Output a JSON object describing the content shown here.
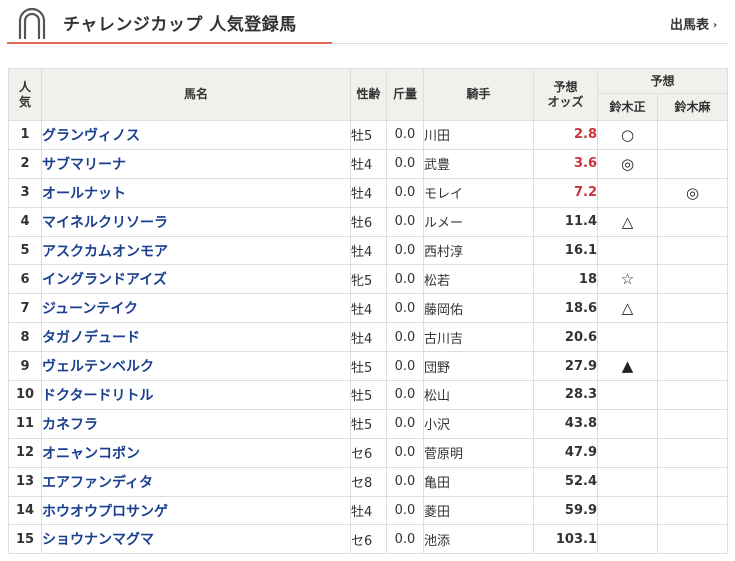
{
  "header": {
    "title": "チャレンジカップ 人気登録馬",
    "link_label": "出馬表",
    "chevron": "›"
  },
  "table": {
    "columns": {
      "rank": "人\n気",
      "horse": "馬名",
      "sex_age": "性齢",
      "weight": "斤量",
      "jockey": "騎手",
      "odds": "予想\nオッズ",
      "prediction_group": "予想",
      "pred1": "鈴木正",
      "pred2": "鈴木麻"
    },
    "rows": [
      {
        "rank": "1",
        "horse": "グランヴィノス",
        "sex_age": "牡5",
        "weight": "0.0",
        "jockey": "川田",
        "odds": "2.8",
        "hot": true,
        "pred1": "○",
        "pred2": ""
      },
      {
        "rank": "2",
        "horse": "サブマリーナ",
        "sex_age": "牡4",
        "weight": "0.0",
        "jockey": "武豊",
        "odds": "3.6",
        "hot": true,
        "pred1": "◎",
        "pred2": ""
      },
      {
        "rank": "3",
        "horse": "オールナット",
        "sex_age": "牡4",
        "weight": "0.0",
        "jockey": "モレイ",
        "odds": "7.2",
        "hot": true,
        "pred1": "",
        "pred2": "◎"
      },
      {
        "rank": "4",
        "horse": "マイネルクリソーラ",
        "sex_age": "牡6",
        "weight": "0.0",
        "jockey": "ルメー",
        "odds": "11.4",
        "hot": false,
        "pred1": "△",
        "pred2": ""
      },
      {
        "rank": "5",
        "horse": "アスクカムオンモア",
        "sex_age": "牡4",
        "weight": "0.0",
        "jockey": "西村淳",
        "odds": "16.1",
        "hot": false,
        "pred1": "",
        "pred2": ""
      },
      {
        "rank": "6",
        "horse": "イングランドアイズ",
        "sex_age": "牝5",
        "weight": "0.0",
        "jockey": "松若",
        "odds": "18",
        "hot": false,
        "pred1": "☆",
        "pred2": ""
      },
      {
        "rank": "7",
        "horse": "ジューンテイク",
        "sex_age": "牡4",
        "weight": "0.0",
        "jockey": "藤岡佑",
        "odds": "18.6",
        "hot": false,
        "pred1": "△",
        "pred2": ""
      },
      {
        "rank": "8",
        "horse": "タガノデュード",
        "sex_age": "牡4",
        "weight": "0.0",
        "jockey": "古川吉",
        "odds": "20.6",
        "hot": false,
        "pred1": "",
        "pred2": ""
      },
      {
        "rank": "9",
        "horse": "ヴェルテンベルク",
        "sex_age": "牡5",
        "weight": "0.0",
        "jockey": "団野",
        "odds": "27.9",
        "hot": false,
        "pred1": "▲",
        "pred2": ""
      },
      {
        "rank": "10",
        "horse": "ドクタードリトル",
        "sex_age": "牡5",
        "weight": "0.0",
        "jockey": "松山",
        "odds": "28.3",
        "hot": false,
        "pred1": "",
        "pred2": ""
      },
      {
        "rank": "11",
        "horse": "カネフラ",
        "sex_age": "牡5",
        "weight": "0.0",
        "jockey": "小沢",
        "odds": "43.8",
        "hot": false,
        "pred1": "",
        "pred2": ""
      },
      {
        "rank": "12",
        "horse": "オニャンコポン",
        "sex_age": "セ6",
        "weight": "0.0",
        "jockey": "菅原明",
        "odds": "47.9",
        "hot": false,
        "pred1": "",
        "pred2": ""
      },
      {
        "rank": "13",
        "horse": "エアファンディタ",
        "sex_age": "セ8",
        "weight": "0.0",
        "jockey": "亀田",
        "odds": "52.4",
        "hot": false,
        "pred1": "",
        "pred2": ""
      },
      {
        "rank": "14",
        "horse": "ホウオウプロサンゲ",
        "sex_age": "牡4",
        "weight": "0.0",
        "jockey": "菱田",
        "odds": "59.9",
        "hot": false,
        "pred1": "",
        "pred2": ""
      },
      {
        "rank": "15",
        "horse": "ショウナンマグマ",
        "sex_age": "セ6",
        "weight": "0.0",
        "jockey": "池添",
        "odds": "103.1",
        "hot": false,
        "pred1": "",
        "pred2": ""
      }
    ]
  },
  "colors": {
    "accent_red": "#c9333a",
    "link_blue": "#1a3f8f",
    "header_bg": "#f0f0ec",
    "underline": "#e06b5a"
  }
}
